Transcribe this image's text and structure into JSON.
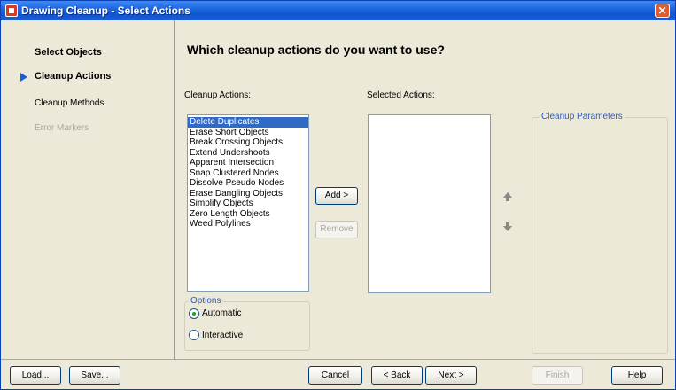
{
  "window": {
    "title": "Drawing Cleanup - Select Actions",
    "icon": "app-icon",
    "close_icon": "close-icon"
  },
  "sidebar": {
    "steps": [
      {
        "label": "Select Objects",
        "state": "done"
      },
      {
        "label": "Cleanup Actions",
        "state": "current"
      },
      {
        "label": "Cleanup Methods",
        "state": "pending"
      },
      {
        "label": "Error Markers",
        "state": "disabled"
      }
    ],
    "current_marker_icon": "arrow-right-icon"
  },
  "main": {
    "question": "Which cleanup actions do you want to use?",
    "cleanup_actions_label": "Cleanup Actions:",
    "cleanup_actions": [
      "Delete Duplicates",
      "Erase Short Objects",
      "Break Crossing Objects",
      "Extend Undershoots",
      "Apparent Intersection",
      "Snap Clustered Nodes",
      "Dissolve Pseudo Nodes",
      "Erase Dangling Objects",
      "Simplify Objects",
      "Zero Length Objects",
      "Weed Polylines"
    ],
    "selected_index": 0,
    "selected_actions_label": "Selected Actions:",
    "selected_actions": [],
    "add_button": "Add >",
    "remove_button": "Remove",
    "move_up_icon": "arrow-up-icon",
    "move_down_icon": "arrow-down-icon",
    "parameters_group": "Cleanup Parameters",
    "options": {
      "title": "Options",
      "automatic": "Automatic",
      "interactive": "Interactive",
      "selected": "Automatic"
    }
  },
  "footer": {
    "load": "Load...",
    "save": "Save...",
    "cancel": "Cancel",
    "back": "< Back",
    "next": "Next >",
    "finish": "Finish",
    "help": "Help"
  },
  "colors": {
    "title_bar": "#1e66e0",
    "selection": "#316ac5",
    "group_title": "#2a5bc8",
    "window_bg": "#ece9d8"
  }
}
